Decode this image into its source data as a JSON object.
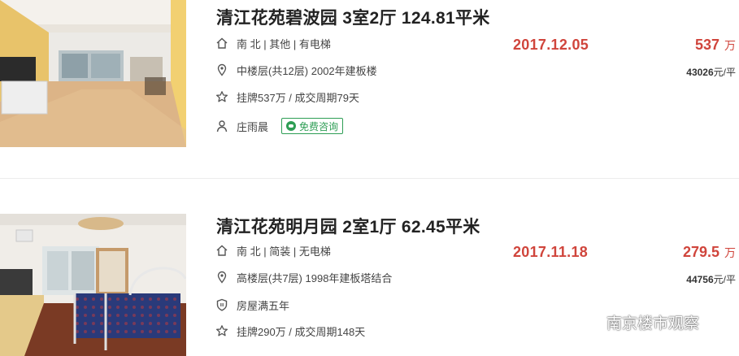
{
  "listings": [
    {
      "title": "清江花苑碧波园 3室2厅 124.81平米",
      "orientation": "南 北 | 其他 | 有电梯",
      "floor": "中楼层(共12层) 2002年建板楼",
      "listing_info": "挂牌537万 / 成交周期79天",
      "agent": "庄雨晨",
      "consult_label": "免费咨询",
      "deal_date": "2017.12.05",
      "price": "537",
      "price_unit": "万",
      "unit_price": "43026",
      "unit_price_suffix": "元/平",
      "icons": [
        "home-icon",
        "location-pin-icon",
        "star-icon",
        "person-icon"
      ]
    },
    {
      "title": "清江花苑明月园 2室1厅 62.45平米",
      "orientation": "南 北 | 简装 | 无电梯",
      "floor": "高楼层(共7层) 1998年建板塔结合",
      "tax": "房屋满五年",
      "listing_info": "挂牌290万 / 成交周期148天",
      "deal_date": "2017.11.18",
      "price": "279.5",
      "price_unit": "万",
      "unit_price": "44756",
      "unit_price_suffix": "元/平",
      "icons": [
        "home-icon",
        "location-pin-icon",
        "shield-icon",
        "star-icon"
      ]
    }
  ],
  "watermark": {
    "text": "南京楼市观察"
  },
  "colors": {
    "price_red": "#d0453c",
    "consult_green": "#2e9e55",
    "text": "#444444"
  }
}
